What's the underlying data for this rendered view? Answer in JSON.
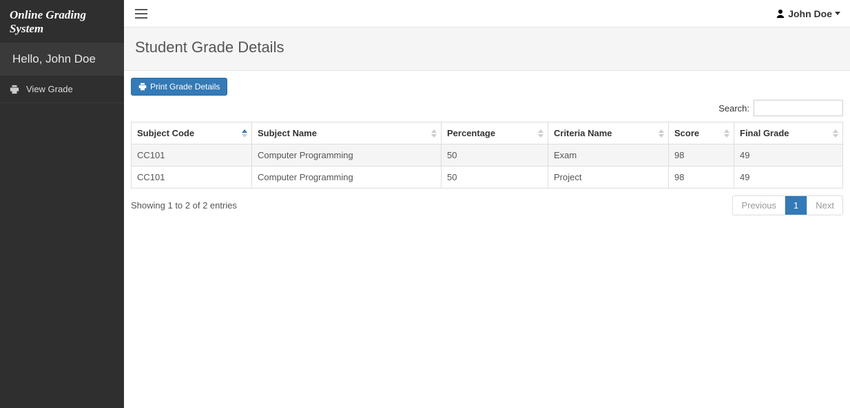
{
  "sidebar": {
    "brand": "Online Grading System",
    "greeting": "Hello, John Doe",
    "nav": [
      {
        "label": "View Grade"
      }
    ]
  },
  "topbar": {
    "user_name": "John Doe"
  },
  "page": {
    "title": "Student Grade Details"
  },
  "actions": {
    "print_label": "Print Grade Details"
  },
  "search": {
    "label": "Search:",
    "value": ""
  },
  "table": {
    "columns": [
      "Subject Code",
      "Subject Name",
      "Percentage",
      "Criteria Name",
      "Score",
      "Final Grade"
    ],
    "rows": [
      {
        "subject_code": "CC101",
        "subject_name": "Computer Programming",
        "percentage": "50",
        "criteria_name": "Exam",
        "score": "98",
        "final_grade": "49"
      },
      {
        "subject_code": "CC101",
        "subject_name": "Computer Programming",
        "percentage": "50",
        "criteria_name": "Project",
        "score": "98",
        "final_grade": "49"
      }
    ],
    "info": "Showing 1 to 2 of 2 entries",
    "pagination": {
      "previous": "Previous",
      "next": "Next",
      "current": "1"
    }
  }
}
